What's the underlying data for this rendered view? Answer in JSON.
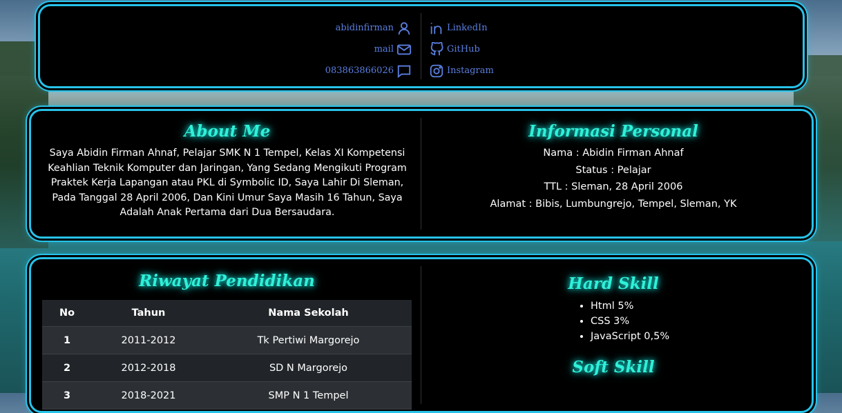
{
  "contact": {
    "left": [
      {
        "label": "abidinfirman",
        "icon": "user-icon"
      },
      {
        "label": "mail",
        "icon": "mail-icon"
      },
      {
        "label": "083863866026",
        "icon": "chat-icon"
      }
    ],
    "right": [
      {
        "label": "LinkedIn",
        "icon": "linkedin-icon"
      },
      {
        "label": "GitHub",
        "icon": "github-icon"
      },
      {
        "label": "Instagram",
        "icon": "instagram-icon"
      }
    ]
  },
  "about": {
    "title": "About Me",
    "text": "Saya Abidin Firman Ahnaf, Pelajar SMK N 1 Tempel, Kelas XI Kompetensi Keahlian Teknik Komputer dan Jaringan, Yang Sedang Mengikuti Program Praktek Kerja Lapangan atau PKL di Symbolic ID, Saya Lahir Di Sleman, Pada Tanggal 28 April 2006, Dan Kini Umur Saya Masih 16 Tahun, Saya Adalah Anak Pertama dari Dua Bersaudara."
  },
  "personal": {
    "title": "Informasi Personal",
    "lines": [
      "Nama : Abidin Firman Ahnaf",
      "Status : Pelajar",
      "TTL : Sleman, 28 April 2006",
      "Alamat : Bibis, Lumbungrejo, Tempel, Sleman, YK"
    ]
  },
  "education": {
    "title": "Riwayat Pendidikan",
    "headers": [
      "No",
      "Tahun",
      "Nama Sekolah"
    ],
    "rows": [
      [
        "1",
        "2011-2012",
        "Tk Pertiwi Margorejo"
      ],
      [
        "2",
        "2012-2018",
        "SD N Margorejo"
      ],
      [
        "3",
        "2018-2021",
        "SMP N 1 Tempel"
      ]
    ]
  },
  "hard_skill": {
    "title": "Hard Skill",
    "items": [
      "Html 5%",
      "CSS 3%",
      "JavaScript 0,5%"
    ]
  },
  "soft_skill": {
    "title": "Soft Skill"
  },
  "colors": {
    "accent_border": "#27c3ea",
    "heading": "#2ff0d8",
    "link": "#5b7fe0"
  }
}
